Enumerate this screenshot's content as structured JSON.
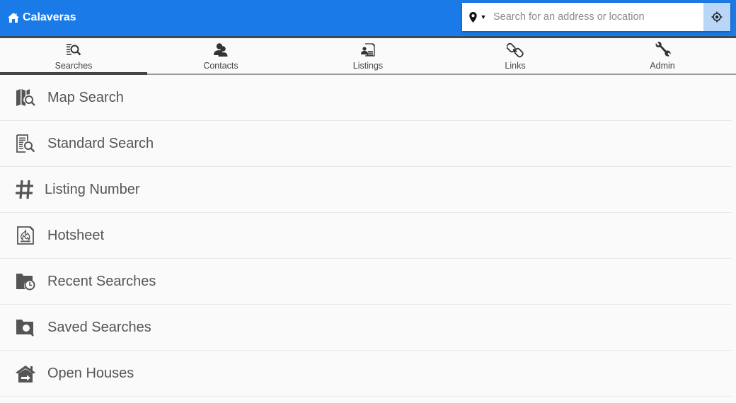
{
  "header": {
    "brand": "Calaveras",
    "brand_icon": "home-icon",
    "search": {
      "placeholder": "Search for an address or location",
      "value": "",
      "location_type_icon": "map-marker-icon",
      "locate_icon": "crosshairs-icon"
    },
    "colors": {
      "bar": "#1a7ae8",
      "locate_button": "#b8d6f8"
    }
  },
  "tabs": [
    {
      "label": "Searches",
      "icon": "search-list-icon",
      "active": true
    },
    {
      "label": "Contacts",
      "icon": "contacts-icon",
      "active": false
    },
    {
      "label": "Listings",
      "icon": "listings-icon",
      "active": false
    },
    {
      "label": "Links",
      "icon": "links-icon",
      "active": false
    },
    {
      "label": "Admin",
      "icon": "wrench-icon",
      "active": false
    }
  ],
  "menu": [
    {
      "label": "Map Search",
      "icon": "map-search-icon"
    },
    {
      "label": "Standard Search",
      "icon": "document-search-icon"
    },
    {
      "label": "Listing Number",
      "icon": "hash-icon"
    },
    {
      "label": "Hotsheet",
      "icon": "hotsheet-fire-icon"
    },
    {
      "label": "Recent Searches",
      "icon": "folder-clock-icon"
    },
    {
      "label": "Saved Searches",
      "icon": "folder-search-icon"
    },
    {
      "label": "Open Houses",
      "icon": "open-house-icon"
    }
  ]
}
